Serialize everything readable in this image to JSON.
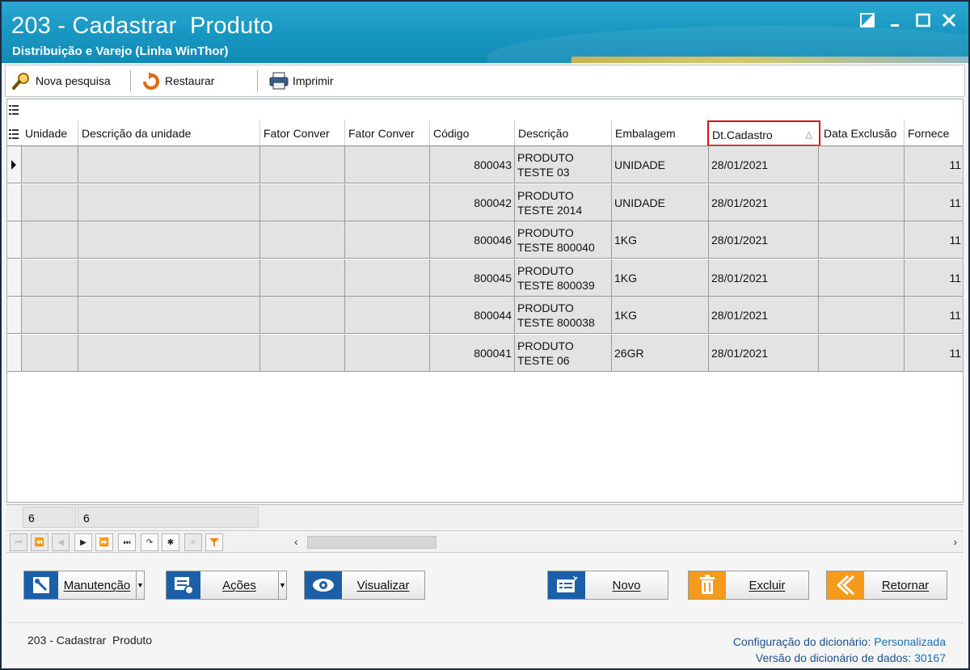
{
  "window": {
    "title": "203 - Cadastrar  Produto",
    "subtitle": "Distribuição e Varejo (Linha WinThor)"
  },
  "toolbar": {
    "search_label": "Nova pesquisa",
    "restore_label": "Restaurar",
    "print_label": "Imprimir"
  },
  "grid": {
    "columns": [
      "Unidade",
      "Descrição da unidade",
      "Fator Conver",
      "Fator Conver",
      "Código",
      "Descrição",
      "Embalagem",
      "Dt.Cadastro",
      "Data Exclusão",
      "Fornece"
    ],
    "sort_indicator": "△",
    "rows": [
      {
        "codigo": "800043",
        "desc1": "PRODUTO",
        "desc2": "TESTE 03",
        "embalagem": "UNIDADE",
        "dtcadastro": "28/01/2021",
        "fornec": "11"
      },
      {
        "codigo": "800042",
        "desc1": "PRODUTO",
        "desc2": "TESTE 2014",
        "embalagem": "UNIDADE",
        "dtcadastro": "28/01/2021",
        "fornec": "11"
      },
      {
        "codigo": "800046",
        "desc1": "PRODUTO",
        "desc2": "TESTE 800040",
        "embalagem": "1KG",
        "dtcadastro": "28/01/2021",
        "fornec": "11"
      },
      {
        "codigo": "800045",
        "desc1": "PRODUTO",
        "desc2": "TESTE 800039",
        "embalagem": "1KG",
        "dtcadastro": "28/01/2021",
        "fornec": "11"
      },
      {
        "codigo": "800044",
        "desc1": "PRODUTO",
        "desc2": "TESTE 800038",
        "embalagem": "1KG",
        "dtcadastro": "28/01/2021",
        "fornec": "11"
      },
      {
        "codigo": "800041",
        "desc1": "PRODUTO",
        "desc2": "TESTE 06",
        "embalagem": "26GR",
        "dtcadastro": "28/01/2021",
        "fornec": "11"
      }
    ],
    "footer": [
      "6",
      "6"
    ]
  },
  "actions": {
    "manutencao": "Manutenção",
    "acoes": "Ações",
    "visualizar": "Visualizar",
    "novo": "Novo",
    "excluir": "Excluir",
    "retornar": "Retornar"
  },
  "status": {
    "left": "203 - Cadastrar  Produto",
    "config_label": "Configuração do dicionário:",
    "config_value": "Personalizada",
    "version_label": "Versão do dicionário de dados:",
    "version_value": "30167"
  },
  "colors": {
    "title_bar": "#1796c1",
    "sort_highlight": "#e01010",
    "accent_orange": "#f59a1b",
    "accent_blue": "#1b5fa8"
  }
}
